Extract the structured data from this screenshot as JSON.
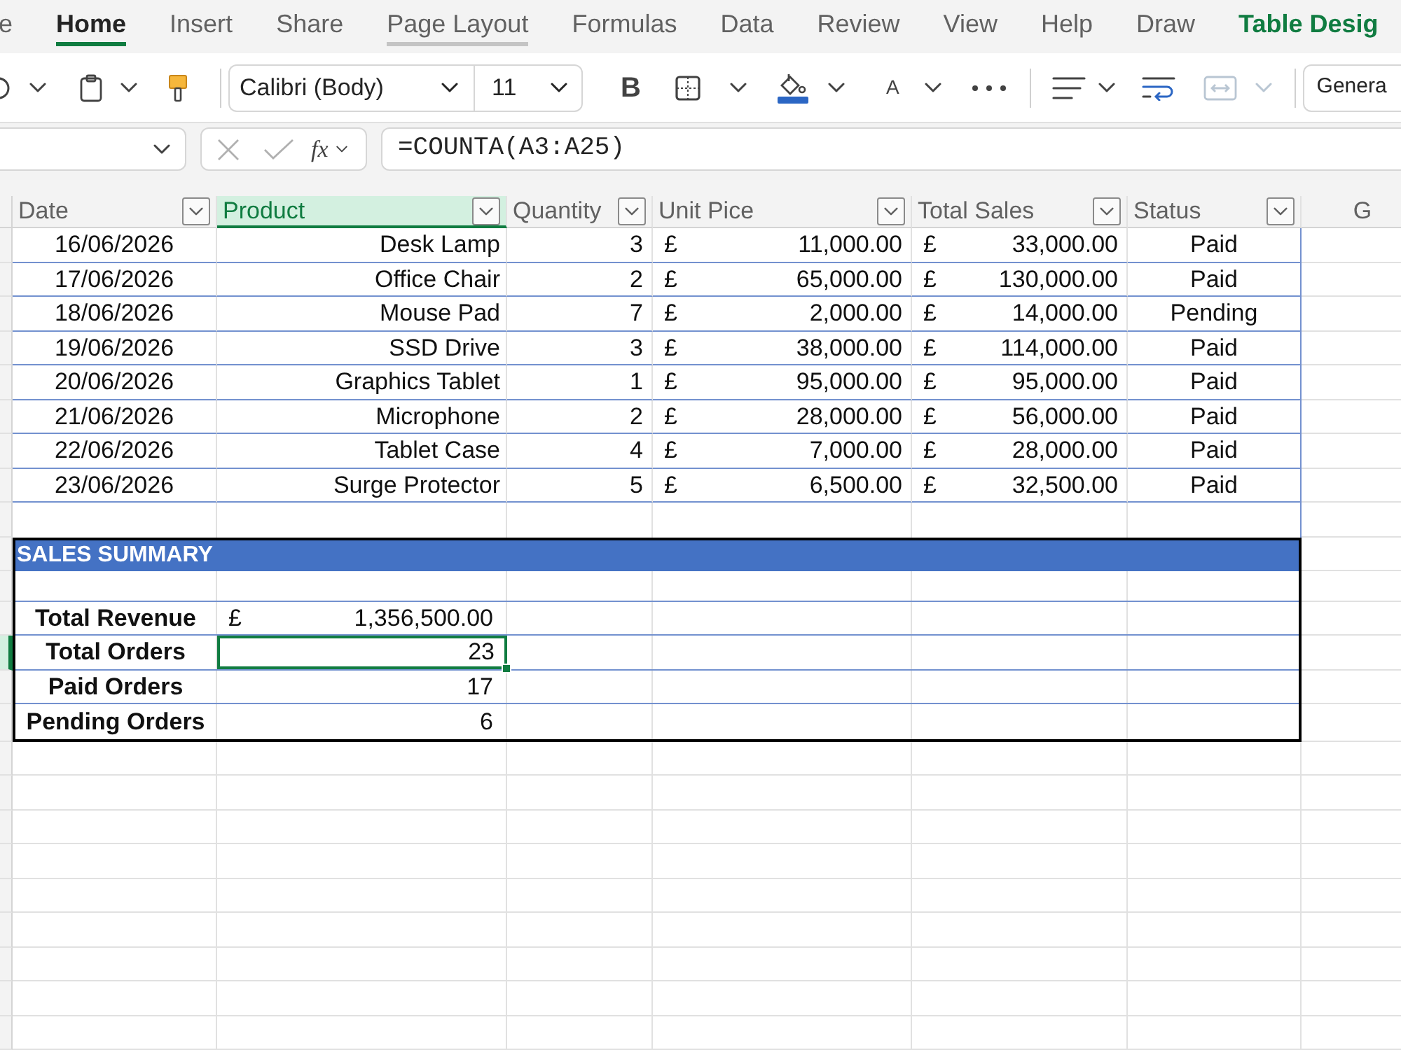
{
  "ribbon_tabs": [
    {
      "label": "e",
      "kind": "standard",
      "selected": false,
      "hovered": false
    },
    {
      "label": "Home",
      "kind": "standard",
      "selected": true,
      "hovered": false
    },
    {
      "label": "Insert",
      "kind": "standard",
      "selected": false,
      "hovered": false
    },
    {
      "label": "Share",
      "kind": "standard",
      "selected": false,
      "hovered": false
    },
    {
      "label": "Page Layout",
      "kind": "standard",
      "selected": false,
      "hovered": true
    },
    {
      "label": "Formulas",
      "kind": "standard",
      "selected": false,
      "hovered": false
    },
    {
      "label": "Data",
      "kind": "standard",
      "selected": false,
      "hovered": false
    },
    {
      "label": "Review",
      "kind": "standard",
      "selected": false,
      "hovered": false
    },
    {
      "label": "View",
      "kind": "standard",
      "selected": false,
      "hovered": false
    },
    {
      "label": "Help",
      "kind": "standard",
      "selected": false,
      "hovered": false
    },
    {
      "label": "Draw",
      "kind": "standard",
      "selected": false,
      "hovered": false
    },
    {
      "label": "Table Desig",
      "kind": "contextual",
      "selected": false,
      "hovered": false
    }
  ],
  "toolbar_groups": [
    {
      "items": [
        {
          "kind": "undo",
          "dropdown": true,
          "disabled": false
        },
        {
          "kind": "paste",
          "dropdown": true,
          "disabled": false
        },
        {
          "kind": "format_painter",
          "dropdown": false,
          "disabled": false
        }
      ]
    },
    {
      "items": [
        {
          "kind": "font",
          "value": "Calibri (Body)",
          "dropdown": true,
          "disabled": false
        },
        {
          "kind": "font_size",
          "value": "11",
          "dropdown": true,
          "disabled": false
        },
        {
          "kind": "bold",
          "label": "B",
          "dropdown": false,
          "disabled": false
        },
        {
          "kind": "borders",
          "dropdown": true,
          "disabled": false
        },
        {
          "kind": "fill_color",
          "dropdown": true,
          "disabled": false
        },
        {
          "kind": "font_color",
          "label": "A",
          "dropdown": true,
          "disabled": false
        },
        {
          "kind": "more",
          "dropdown": false,
          "disabled": false
        }
      ]
    },
    {
      "items": [
        {
          "kind": "align",
          "dropdown": true,
          "disabled": false
        },
        {
          "kind": "wrap_text",
          "dropdown": false,
          "disabled": false
        },
        {
          "kind": "merge",
          "dropdown": true,
          "disabled": true
        }
      ]
    },
    {
      "items": [
        {
          "kind": "number_format",
          "value": "Genera",
          "dropdown": false,
          "disabled": false
        }
      ]
    }
  ],
  "formula_bar": {
    "function_label": "fx",
    "formula": "=COUNTA(A3:A25)"
  },
  "columns": [
    {
      "kind": "table_header",
      "label": "Date",
      "selected": false
    },
    {
      "kind": "table_header",
      "label": "Product",
      "selected": true
    },
    {
      "kind": "table_header",
      "label": "Quantity",
      "selected": false
    },
    {
      "kind": "table_header",
      "label": "Unit Pice",
      "selected": false
    },
    {
      "kind": "table_header",
      "label": "Total Sales",
      "selected": false
    },
    {
      "kind": "table_header",
      "label": "Status",
      "selected": false
    },
    {
      "kind": "column_letter",
      "label": "G",
      "selected": false
    }
  ],
  "rows": [
    {
      "date": "16/06/2026",
      "product": "Desk Lamp",
      "quantity": "3",
      "unit_price": {
        "currency": "£",
        "amount": "11,000.00"
      },
      "total_sales": {
        "currency": "£",
        "amount": "33,000.00"
      },
      "status": "Paid"
    },
    {
      "date": "17/06/2026",
      "product": "Office Chair",
      "quantity": "2",
      "unit_price": {
        "currency": "£",
        "amount": "65,000.00"
      },
      "total_sales": {
        "currency": "£",
        "amount": "130,000.00"
      },
      "status": "Paid"
    },
    {
      "date": "18/06/2026",
      "product": "Mouse Pad",
      "quantity": "7",
      "unit_price": {
        "currency": "£",
        "amount": "2,000.00"
      },
      "total_sales": {
        "currency": "£",
        "amount": "14,000.00"
      },
      "status": "Pending"
    },
    {
      "date": "19/06/2026",
      "product": "SSD Drive",
      "quantity": "3",
      "unit_price": {
        "currency": "£",
        "amount": "38,000.00"
      },
      "total_sales": {
        "currency": "£",
        "amount": "114,000.00"
      },
      "status": "Paid"
    },
    {
      "date": "20/06/2026",
      "product": "Graphics Tablet",
      "quantity": "1",
      "unit_price": {
        "currency": "£",
        "amount": "95,000.00"
      },
      "total_sales": {
        "currency": "£",
        "amount": "95,000.00"
      },
      "status": "Paid"
    },
    {
      "date": "21/06/2026",
      "product": "Microphone",
      "quantity": "2",
      "unit_price": {
        "currency": "£",
        "amount": "28,000.00"
      },
      "total_sales": {
        "currency": "£",
        "amount": "56,000.00"
      },
      "status": "Paid"
    },
    {
      "date": "22/06/2026",
      "product": "Tablet Case",
      "quantity": "4",
      "unit_price": {
        "currency": "£",
        "amount": "7,000.00"
      },
      "total_sales": {
        "currency": "£",
        "amount": "28,000.00"
      },
      "status": "Paid"
    },
    {
      "date": "23/06/2026",
      "product": "Surge Protector",
      "quantity": "5",
      "unit_price": {
        "currency": "£",
        "amount": "6,500.00"
      },
      "total_sales": {
        "currency": "£",
        "amount": "32,500.00"
      },
      "status": "Paid"
    }
  ],
  "summary": {
    "title": "SALES SUMMARY",
    "rows": [
      {
        "label": "Total Revenue",
        "currency": "£",
        "value": "1,356,500.00",
        "selected": false
      },
      {
        "label": "Total Orders",
        "value": "23",
        "selected": true
      },
      {
        "label": "Paid Orders",
        "value": "17",
        "selected": false
      },
      {
        "label": "Pending Orders",
        "value": "6",
        "selected": false
      }
    ]
  }
}
